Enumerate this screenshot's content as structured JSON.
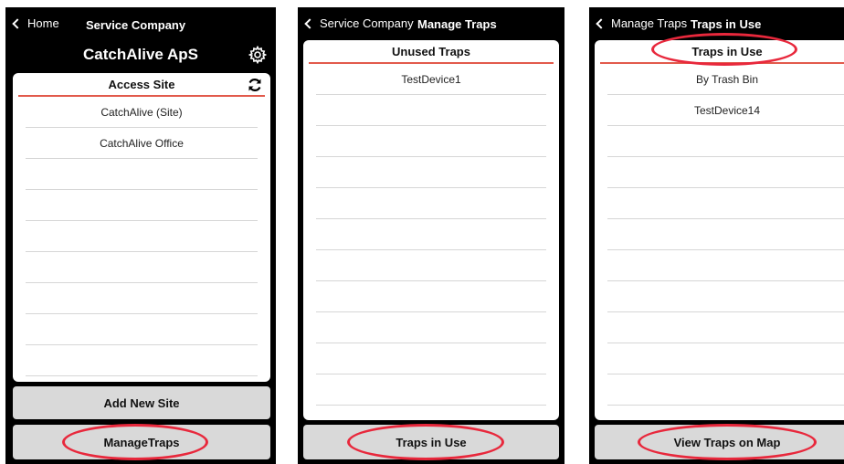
{
  "screen1": {
    "back_label": "Home",
    "nav_title": "Service Company",
    "company_title": "CatchAlive ApS",
    "list_header": "Access Site",
    "items": [
      "CatchAlive (Site)",
      "CatchAlive Office",
      "",
      "",
      "",
      "",
      "",
      "",
      ""
    ],
    "add_button": "Add New Site",
    "manage_button": "ManageTraps"
  },
  "screen2": {
    "back_label": "Service Company",
    "nav_title": "Manage Traps",
    "list_header": "Unused Traps",
    "items": [
      "TestDevice1",
      "",
      "",
      "",
      "",
      "",
      "",
      "",
      "",
      "",
      ""
    ],
    "bottom_button": "Traps in Use"
  },
  "screen3": {
    "back_label": "Manage Traps",
    "nav_title": "Traps in Use",
    "list_header": "Traps in Use",
    "items": [
      "By Trash Bin",
      "TestDevice14",
      "",
      "",
      "",
      "",
      "",
      "",
      "",
      "",
      ""
    ],
    "bottom_button": "View Traps on Map"
  },
  "colors": {
    "highlight_ring": "#e8283c",
    "header_divider": "#e25a4c",
    "button_bg": "#d9d9d9"
  },
  "icons": [
    "chevron-left-icon",
    "gear-icon",
    "refresh-icon"
  ]
}
